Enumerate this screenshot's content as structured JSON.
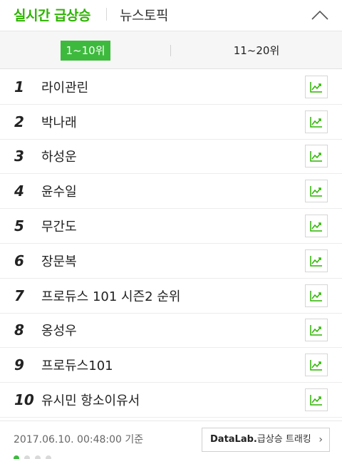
{
  "header": {
    "active_tab": "실시간 급상승",
    "other_tab": "뉴스토픽",
    "collapse_icon": "chevron-up-icon"
  },
  "range": {
    "active": "1~10위",
    "inactive": "11~20위"
  },
  "colors": {
    "accent": "#2db400",
    "button_green": "#3dba3d"
  },
  "ranking": [
    {
      "rank": "1",
      "keyword": "라이관린"
    },
    {
      "rank": "2",
      "keyword": "박나래"
    },
    {
      "rank": "3",
      "keyword": "하성운"
    },
    {
      "rank": "4",
      "keyword": "윤수일"
    },
    {
      "rank": "5",
      "keyword": "무간도"
    },
    {
      "rank": "6",
      "keyword": "장문복"
    },
    {
      "rank": "7",
      "keyword": "프로듀스 101 시즌2 순위"
    },
    {
      "rank": "8",
      "keyword": "옹성우"
    },
    {
      "rank": "9",
      "keyword": "프로듀스101"
    },
    {
      "rank": "10",
      "keyword": "유시민 항소이유서"
    }
  ],
  "trend_icon": "trend-chart-icon",
  "footer": {
    "timestamp": "2017.06.10. 00:48:00 기준",
    "datalab_brand": "DataLab.",
    "datalab_rest": "급상승 트래킹",
    "datalab_chevron": "›"
  },
  "pagination": {
    "current": 1,
    "total": 4
  }
}
